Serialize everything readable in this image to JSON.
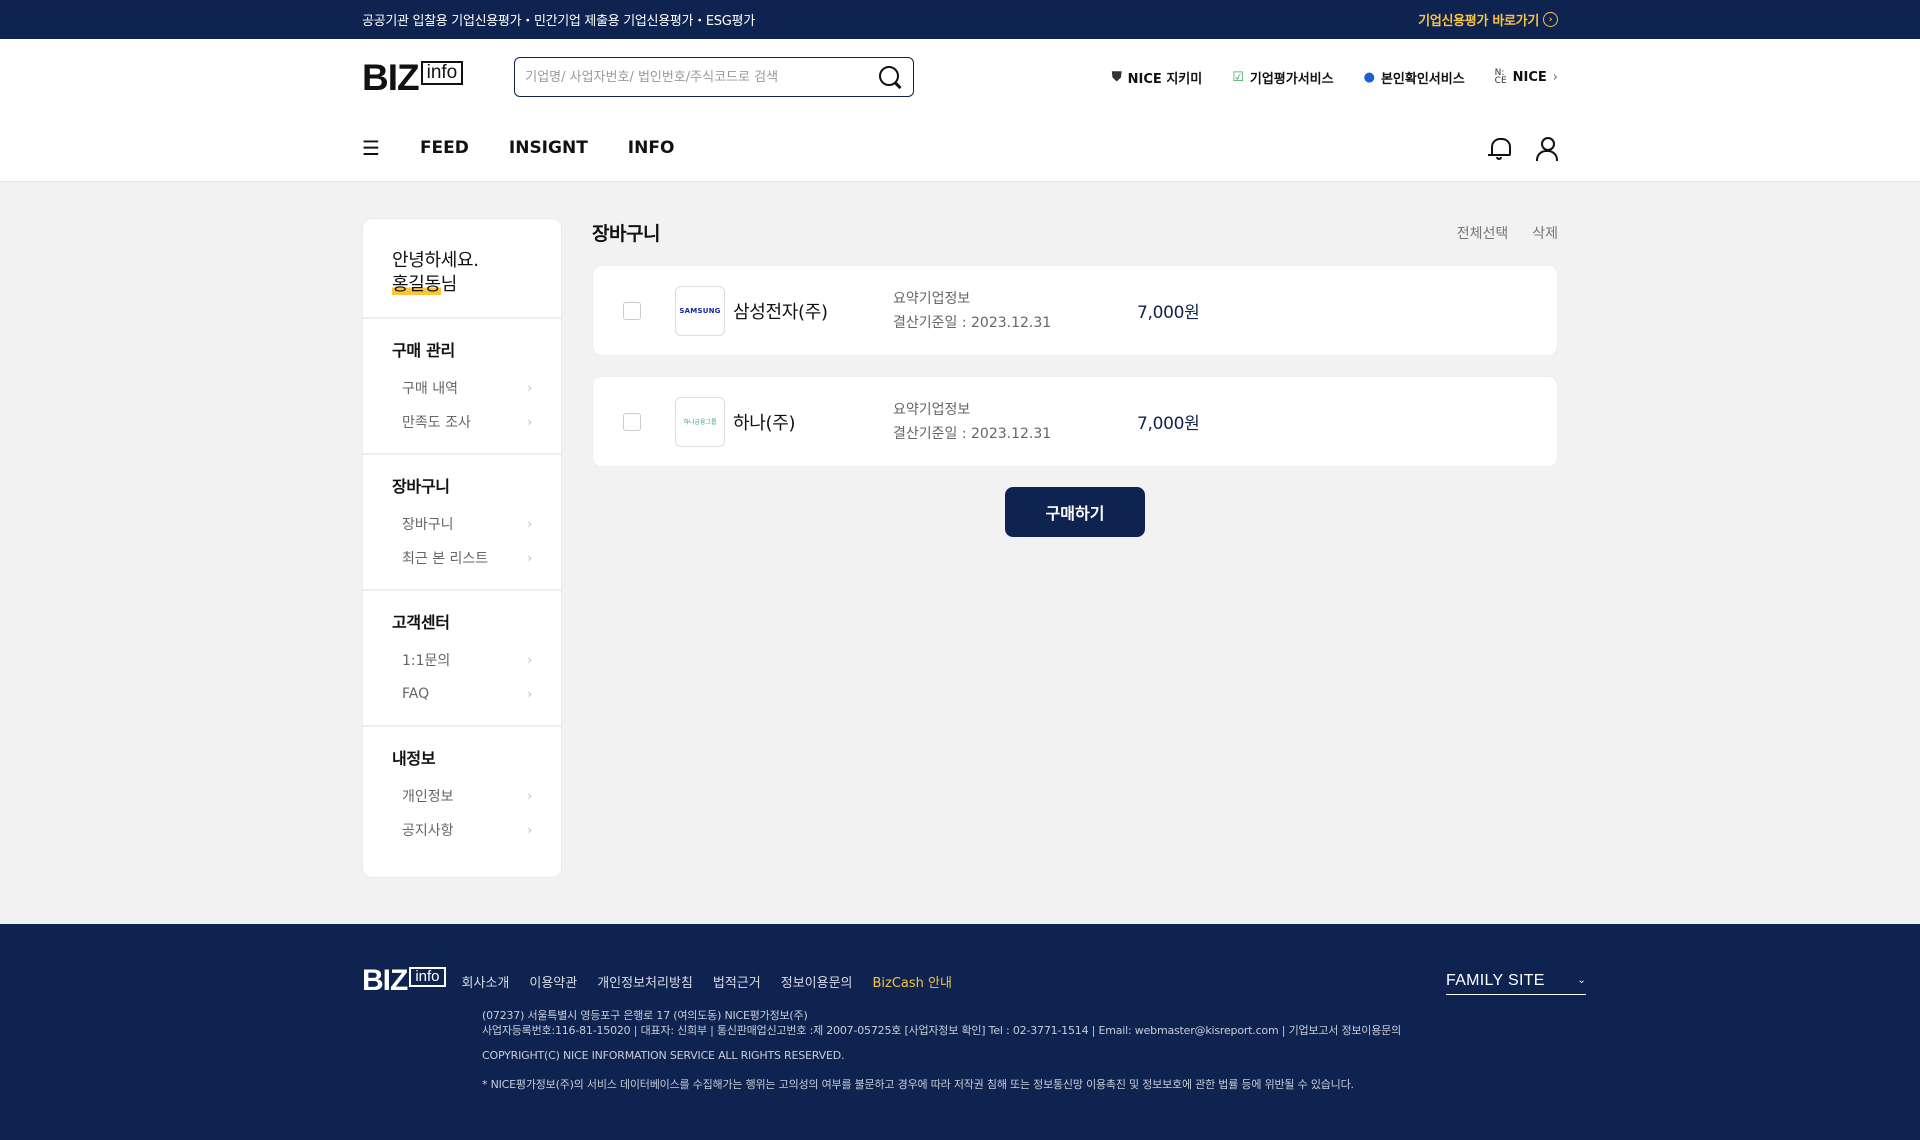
{
  "topbar": {
    "announce": "공공기관 입찰용 기업신용평가・민간기업 제출용 기업신용평가・ESG평가",
    "quick_link": "기업신용평가 바로가기"
  },
  "header": {
    "logo_text": "BIZ",
    "logo_sub": "info",
    "search_placeholder": "기업명/ 사업자번호/ 법인번호/주식코드로 검색",
    "util": [
      {
        "icon": "shield-icon",
        "label": "NICE 지키미"
      },
      {
        "icon": "check-icon",
        "label": "기업평가서비스"
      },
      {
        "icon": "person-icon",
        "label": "본인확인서비스"
      },
      {
        "icon": "nice-icon",
        "label": "NICE"
      }
    ],
    "nav": [
      "FEED",
      "INSIGNT",
      "INFO"
    ]
  },
  "sidebar": {
    "greeting": "안녕하세요.",
    "user_name": "홍길동",
    "user_suffix": "님",
    "groups": [
      {
        "title": "구매 관리",
        "items": [
          "구매 내역",
          "만족도 조사"
        ]
      },
      {
        "title": "장바구니",
        "items": [
          "장바구니",
          "최근 본 리스트"
        ]
      },
      {
        "title": "고객센터",
        "items": [
          "1:1문의",
          "FAQ"
        ]
      },
      {
        "title": "내정보",
        "items": [
          "개인정보",
          "공지사항"
        ]
      }
    ]
  },
  "cart": {
    "title": "장바구니",
    "select_all": "전체선택",
    "delete": "삭제",
    "items": [
      {
        "logo": "SAMSUNG",
        "company": "삼성전자(주)",
        "info_title": "요약기업정보",
        "info_date": "결산기준일 : 2023.12.31",
        "price": "7,000원"
      },
      {
        "logo": "하나금융그룹",
        "company": "하나(주)",
        "info_title": "요약기업정보",
        "info_date": "결산기준일 : 2023.12.31",
        "price": "7,000원"
      }
    ],
    "buy_label": "구매하기"
  },
  "footer": {
    "links": [
      "회사소개",
      "이용약관",
      "개인정보처리방침",
      "법적근거",
      "정보이용문의",
      "BizCash 안내"
    ],
    "family_site": "FAMILY SITE",
    "address": "(07237) 서울특별시 영등포구 은행로 17 (여의도동) NICE평가정보(주)",
    "business": "사업자등록번호:116-81-15020  |  대표자: 신희부  |  통신판매업신고번호 :제 2007-05725호 [사업자정보 확인]  Tel : 02-3771-1514  |  Email: webmaster@kisreport.com  |  기업보고서 정보이용문의",
    "copyright": "COPYRIGHT(C) NICE INFORMATION SERVICE ALL RIGHTS RESERVED.",
    "notice": "* NICE평가정보(주)의 서비스 데이터베이스를 수집해가는 행위는 고의성의 여부를 불문하고 경우에 따라 저작권 침해 또는 정보통신망 이용촉진 및 정보보호에 관한 법률 등에 위반될 수 있습니다."
  },
  "colors": {
    "navy": "#0e2350",
    "accent": "#f6c344"
  }
}
